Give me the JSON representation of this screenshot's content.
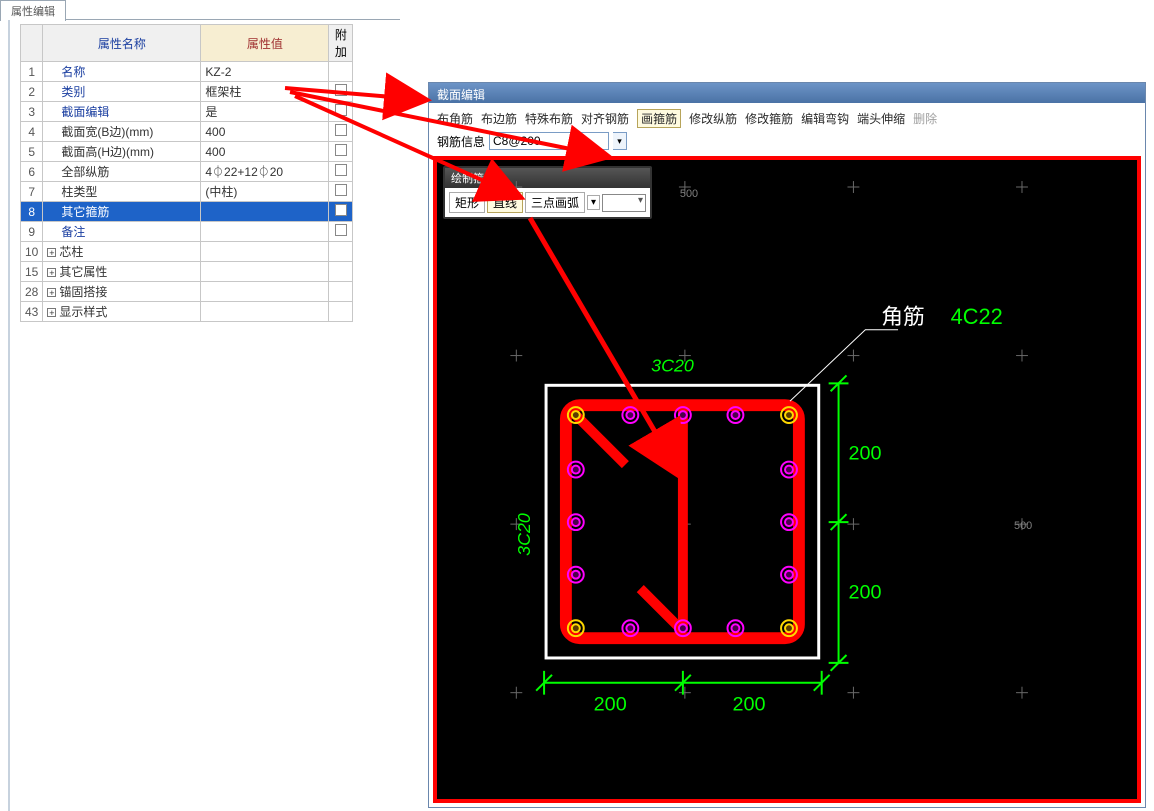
{
  "tab_title": "属性编辑",
  "table": {
    "headers": {
      "num": "",
      "name": "属性名称",
      "val": "属性值",
      "add": "附加"
    },
    "rows": [
      {
        "n": "1",
        "name": "名称",
        "val": "KZ-2",
        "blue": true,
        "add": false
      },
      {
        "n": "2",
        "name": "类别",
        "val": "框架柱",
        "blue": true,
        "add": true
      },
      {
        "n": "3",
        "name": "截面编辑",
        "val": "是",
        "blue": true,
        "add": true
      },
      {
        "n": "4",
        "name": "截面宽(B边)(mm)",
        "val": "400",
        "blue": false,
        "add": true
      },
      {
        "n": "5",
        "name": "截面高(H边)(mm)",
        "val": "400",
        "blue": false,
        "add": true
      },
      {
        "n": "6",
        "name": "全部纵筋",
        "val": "4⏀22+12⏀20",
        "blue": false,
        "add": true
      },
      {
        "n": "7",
        "name": "柱类型",
        "val": "(中柱)",
        "blue": false,
        "add": true
      },
      {
        "n": "8",
        "name": "其它箍筋",
        "val": "",
        "blue": false,
        "add": true,
        "selected": true
      },
      {
        "n": "9",
        "name": "备注",
        "val": "",
        "blue": true,
        "add": true
      },
      {
        "n": "10",
        "name": "芯柱",
        "val": "",
        "blue": false,
        "add": false,
        "exp": true
      },
      {
        "n": "15",
        "name": "其它属性",
        "val": "",
        "blue": false,
        "add": false,
        "exp": true
      },
      {
        "n": "28",
        "name": "锚固搭接",
        "val": "",
        "blue": false,
        "add": false,
        "exp": true
      },
      {
        "n": "43",
        "name": "显示样式",
        "val": "",
        "blue": false,
        "add": false,
        "exp": true
      }
    ]
  },
  "editor": {
    "title": "截面编辑",
    "toolbar": [
      "布角筋",
      "布边筋",
      "特殊布筋",
      "对齐钢筋",
      "画箍筋",
      "修改纵筋",
      "修改箍筋",
      "编辑弯钩",
      "端头伸缩",
      "删除"
    ],
    "toolbar_active": "画箍筋",
    "param_label": "钢筋信息",
    "param_value": "C8@200",
    "drawbox": {
      "title": "绘制箍筋",
      "buttons": [
        "矩形",
        "直线",
        "三点画弧"
      ],
      "active": "直线"
    },
    "axis_500a": "500",
    "axis_500b": "500",
    "labels": {
      "top": "3C20",
      "left": "3C20",
      "corner_w": "角筋",
      "corner_g": "4C22",
      "dim200": "200"
    }
  }
}
